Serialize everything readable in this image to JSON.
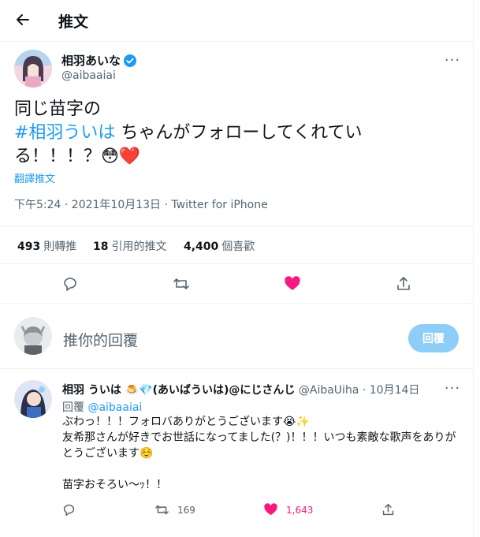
{
  "header": {
    "title": "推文"
  },
  "tweet": {
    "display_name": "相羽あいな",
    "handle": "@aibaaiai",
    "text_line1": "同じ苗字の",
    "hashtag": "#相羽ういは",
    "text_line2_rest": " ちゃんがフォローしてくれてい",
    "text_line3": "る！！！？😳❤️",
    "translate": "翻譯推文",
    "timestamp": "下午5:24 · 2021年10月13日 · Twitter for iPhone"
  },
  "stats": [
    {
      "num": "493",
      "label": "則轉推"
    },
    {
      "num": "18",
      "label": "引用的推文"
    },
    {
      "num": "4,400",
      "label": "個喜歡"
    }
  ],
  "compose": {
    "placeholder": "推你的回覆",
    "button": "回覆"
  },
  "reply": {
    "display_name": "相羽 ういは 🍮💎(あいばういは)@にじさんじ",
    "handle": "@AibaUiha",
    "date": "· 10月14日",
    "replying_label": "回覆",
    "replying_to": "@aibaaiai",
    "text": "ぶわっ！！！フォロバありがとうございます😭✨\n友希那さんが好きでお世話になってました(？)！！！いつも素敵な歌声をありがとうございます☺️\n\n苗字おそろい〜ｯ！！",
    "retweets": "169",
    "likes": "1,643"
  },
  "colors": {
    "accent": "#1d9bf0",
    "like": "#f91880",
    "muted": "#536471",
    "verified": "#1d9bf0"
  }
}
